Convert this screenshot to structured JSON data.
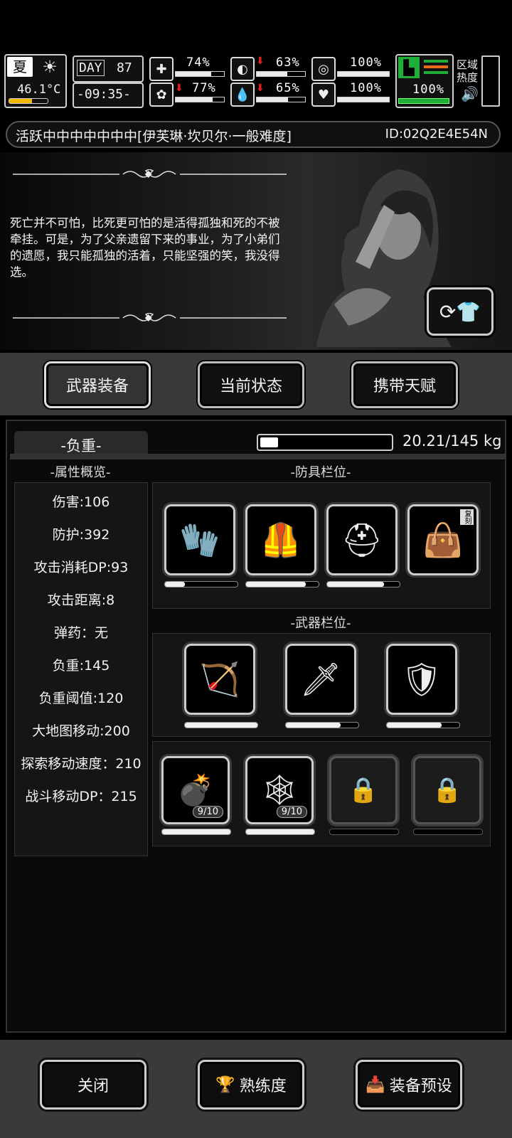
{
  "hud": {
    "season": "夏",
    "temperature": "46.1°C",
    "day_label": "DAY",
    "day_number": "87",
    "time": "-09:35-",
    "stats": {
      "health": "74%",
      "stomach": "63%",
      "stamina": "100%",
      "mind": "77%",
      "water": "65%",
      "heart": "100%",
      "leg": "100%"
    },
    "stat_levels": {
      "health": 0.74,
      "stomach": 0.63,
      "stamina": 1.0,
      "mind": 0.77,
      "water": 0.65,
      "heart": 1.0,
      "leg": 1.0
    },
    "zone_label_1": "区域",
    "zone_label_2": "热度"
  },
  "character": {
    "name_line": "活跃中中中中中中中[伊芙琳·坎贝尔·一般难度]",
    "id": "ID:02Q2E4E54N",
    "quote": "死亡并不可怕，比死更可怕的是活得孤独和死的不被牵挂。可是，为了父亲遗留下来的事业，为了小弟们的遗愿，我只能孤独的活着，只能坚强的笑，我没得选。"
  },
  "tabs": [
    "武器装备",
    "当前状态",
    "携带天赋"
  ],
  "load": {
    "label": "-负重-",
    "text": "20.21/145 kg",
    "fraction": 0.14
  },
  "attributes": {
    "header": "-属性概览-",
    "items": [
      "伤害:106",
      "防护:392",
      "攻击消耗DP:93",
      "攻击距离:8",
      "弹药：无",
      "负重:145",
      "负重阈值:120",
      "大地图移动:200",
      "探索移动速度：210",
      "战斗移动DP：215"
    ]
  },
  "armor": {
    "header": "-防具栏位-",
    "slots": [
      {
        "icon": "gloves-icon",
        "durability": 0.27
      },
      {
        "icon": "body-armor-icon",
        "durability": 0.82
      },
      {
        "icon": "helmet-icon",
        "durability": 0.78
      },
      {
        "icon": "bag-icon",
        "badge": "复刻",
        "durability": 0
      }
    ]
  },
  "weapons": {
    "header": "-武器栏位-",
    "slots": [
      {
        "icon": "crossbow-icon",
        "durability": 1.0
      },
      {
        "icon": "knife-icon",
        "durability": 0.75
      },
      {
        "icon": "shield-icon",
        "durability": 0.75
      }
    ]
  },
  "items": {
    "slots": [
      {
        "icon": "grenade-icon",
        "count": "9/10",
        "durability": 1.0
      },
      {
        "icon": "net-icon",
        "count": "9/10",
        "durability": 1.0
      },
      {
        "icon": "lock-icon",
        "locked": true
      },
      {
        "icon": "lock-icon",
        "locked": true
      }
    ]
  },
  "footer": {
    "close": "关闭",
    "proficiency": "熟练度",
    "preset": "装备预设"
  }
}
